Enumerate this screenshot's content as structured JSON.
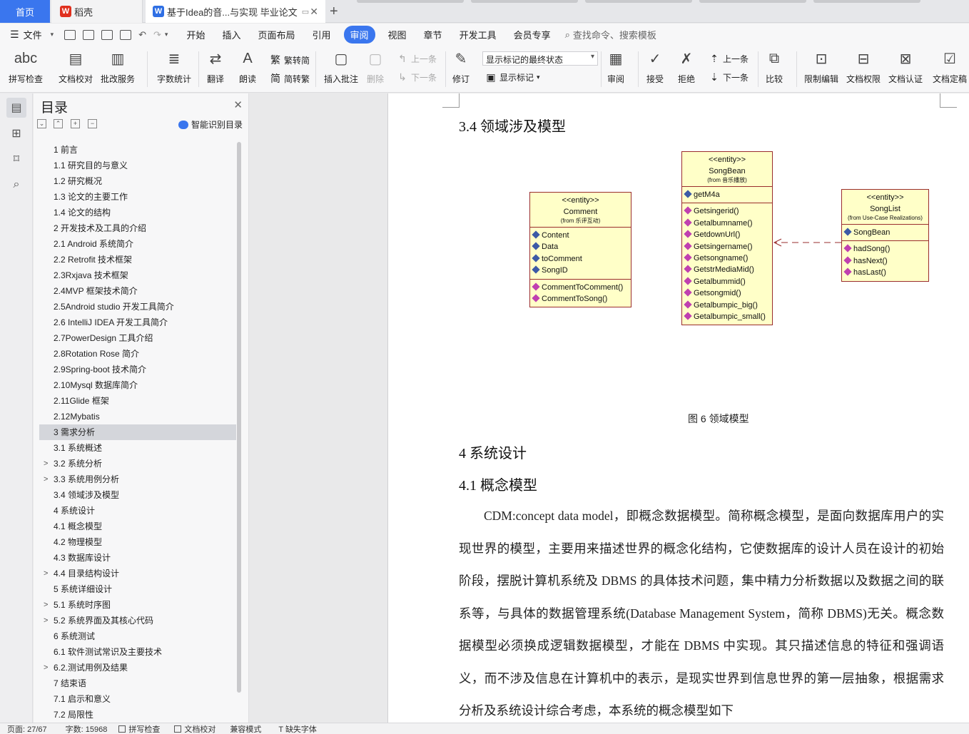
{
  "tabs": {
    "home": "首页",
    "wps_cloud": "稻壳",
    "document": "基于Idea的音...与实现 毕业论文"
  },
  "menu": {
    "file": "文件",
    "items": [
      "开始",
      "插入",
      "页面布局",
      "引用",
      "审阅",
      "视图",
      "章节",
      "开发工具",
      "会员专享"
    ],
    "active": "审阅",
    "search_placeholder": "查找命令、搜索模板"
  },
  "ribbon": {
    "spell_check": "拼写检查",
    "doc_proofread": "文档校对",
    "batch_service": "批改服务",
    "word_count": "字数统计",
    "translate": "翻译",
    "read_aloud": "朗读",
    "trad_to_simp": "繁转简",
    "simp_to_trad": "简转繁",
    "insert_comment": "插入批注",
    "delete": "删除",
    "prev_comment": "上一条",
    "next_comment": "下一条",
    "track_changes": "修订",
    "markup_mode": "显示标记的最终状态",
    "show_markup": "显示标记",
    "review": "审阅",
    "accept": "接受",
    "reject": "拒绝",
    "prev_change": "上一条",
    "next_change": "下一条",
    "compare": "比较",
    "restrict_edit": "限制编辑",
    "doc_permission": "文档权限",
    "doc_cert": "文档认证",
    "doc_finalize": "文档定稿"
  },
  "toc": {
    "title": "目录",
    "smart_label": "智能识别目录",
    "items": [
      {
        "label": "1  前言",
        "arrow": ""
      },
      {
        "label": "1.1 研究目的与意义",
        "arrow": ""
      },
      {
        "label": "1.2 研究概况",
        "arrow": ""
      },
      {
        "label": "1.3  论文的主要工作",
        "arrow": ""
      },
      {
        "label": "1.4  论文的结构",
        "arrow": ""
      },
      {
        "label": "2 开发技术及工具的介绍",
        "arrow": ""
      },
      {
        "label": "2.1 Android 系统简介",
        "arrow": ""
      },
      {
        "label": "2.2 Retrofit 技术框架",
        "arrow": ""
      },
      {
        "label": "2.3Rxjava 技术框架",
        "arrow": ""
      },
      {
        "label": "2.4MVP 框架技术简介",
        "arrow": ""
      },
      {
        "label": "2.5Android studio 开发工具简介",
        "arrow": ""
      },
      {
        "label": "2.6 IntelliJ IDEA 开发工具简介",
        "arrow": ""
      },
      {
        "label": "2.7PowerDesign 工具介绍",
        "arrow": ""
      },
      {
        "label": "2.8Rotation Rose 简介",
        "arrow": ""
      },
      {
        "label": "2.9Spring-boot 技术简介",
        "arrow": ""
      },
      {
        "label": "2.10Mysql 数据库简介",
        "arrow": ""
      },
      {
        "label": "2.11Glide 框架",
        "arrow": ""
      },
      {
        "label": "2.12Mybatis",
        "arrow": ""
      },
      {
        "label": "3 需求分析",
        "arrow": ""
      },
      {
        "label": "3.1 系统概述",
        "arrow": ""
      },
      {
        "label": "3.2 系统分析",
        "arrow": ">"
      },
      {
        "label": "3.3 系统用例分析",
        "arrow": ">"
      },
      {
        "label": "3.4 领域涉及模型",
        "arrow": ""
      },
      {
        "label": "4 系统设计",
        "arrow": ""
      },
      {
        "label": "4.1 概念模型",
        "arrow": ""
      },
      {
        "label": "4.2 物理模型",
        "arrow": ""
      },
      {
        "label": "4.3  数据库设计",
        "arrow": ""
      },
      {
        "label": "4.4  目录结构设计",
        "arrow": ">"
      },
      {
        "label": "5  系统详细设计",
        "arrow": ""
      },
      {
        "label": "5.1 系统时序图",
        "arrow": ">"
      },
      {
        "label": "5.2 系统界面及其核心代码",
        "arrow": ">"
      },
      {
        "label": "6 系统测试",
        "arrow": ""
      },
      {
        "label": "6.1  软件测试常识及主要技术",
        "arrow": ""
      },
      {
        "label": "6.2.测试用例及结果",
        "arrow": ">"
      },
      {
        "label": "7 结束语",
        "arrow": ""
      },
      {
        "label": "7.1 启示和意义",
        "arrow": ""
      },
      {
        "label": "7.2 局限性",
        "arrow": ""
      }
    ],
    "selected_index": 18
  },
  "document": {
    "heading_34": "3.4 领域涉及模型",
    "uml": {
      "comment": {
        "stereotype": "<<entity>>",
        "name": "Comment",
        "from": "(from 乐评互动)",
        "attributes": [
          "Content",
          "Data",
          "toComment",
          "SongID"
        ],
        "operations": [
          "CommentToComment()",
          "CommentToSong()"
        ]
      },
      "songbean": {
        "stereotype": "<<entity>>",
        "name": "SongBean",
        "from": "(from 音乐播放)",
        "attributes": [
          "getM4a"
        ],
        "operations": [
          "Getsingerid()",
          "Getalbumname()",
          "GetdownUrl()",
          "Getsingername()",
          "Getsongname()",
          "GetstrMediaMid()",
          "Getalbummid()",
          "Getsongmid()",
          "Getalbumpic_big()",
          "Getalbumpic_small()"
        ]
      },
      "songlist": {
        "stereotype": "<<entity>>",
        "name": "SongList",
        "from": "(from Use-Case Realizations)",
        "attributes": [
          "SongBean"
        ],
        "operations": [
          "hadSong()",
          "hasNext()",
          "hasLast()"
        ]
      }
    },
    "figure_caption": "图 6 领域模型",
    "heading_4": "4 系统设计",
    "heading_41": "4.1 概念模型",
    "paragraph": "CDM:concept data model，即概念数据模型。简称概念模型，是面向数据库用户的实现世界的模型，主要用来描述世界的概念化结构，它使数据库的设计人员在设计的初始阶段，摆脱计算机系统及 DBMS 的具体技术问题，集中精力分析数据以及数据之间的联系等，与具体的数据管理系统(Database Management System，简称 DBMS)无关。概念数据模型必须换成逻辑数据模型，才能在 DBMS 中实现。其只描述信息的特征和强调语义，而不涉及信息在计算机中的表示，是现实世界到信息世界的第一层抽象，根据需求分析及系统设计综合考虑，本系统的概念模型如下"
  },
  "status": {
    "page": "页面: 27/67",
    "word_count": "字数: 15968",
    "spell_check": "拼写检查",
    "doc_proofread": "文档校对",
    "compat_mode": "兼容模式",
    "missing_font": "缺失字体"
  },
  "colors": {
    "accent": "#3a76ee",
    "uml_fill": "#ffffc8",
    "uml_border": "#9a2d2d"
  }
}
